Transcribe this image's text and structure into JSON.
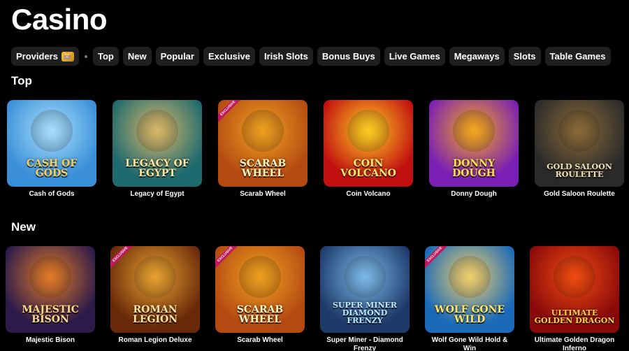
{
  "page": {
    "title": "Casino"
  },
  "filters": {
    "providers_label": "Providers",
    "providers_badge": "🎰",
    "items": [
      "Top",
      "New",
      "Popular",
      "Exclusive",
      "Irish Slots",
      "Bonus Buys",
      "Live Games",
      "Megaways",
      "Slots",
      "Table Games"
    ]
  },
  "sections": {
    "top": {
      "title": "Top",
      "games": [
        {
          "name": "Cash of Gods",
          "logo": "Cash of Gods",
          "bg": "#3a8fd8",
          "bg2": "#a8e0ff",
          "logo_color": "#f5d060",
          "exclusive": false
        },
        {
          "name": "Legacy of Egypt",
          "logo": "Legacy of Egypt",
          "bg": "#1d6a6f",
          "bg2": "#d8b86a",
          "logo_color": "#ffe6a3",
          "exclusive": false
        },
        {
          "name": "Scarab Wheel",
          "logo": "Scarab Wheel",
          "bg": "#b44a12",
          "bg2": "#f0a020",
          "logo_color": "#fff3c0",
          "exclusive": true
        },
        {
          "name": "Coin Volcano",
          "logo": "Coin Volcano",
          "bg": "#c21010",
          "bg2": "#ffcc22",
          "logo_color": "#ffe96a",
          "exclusive": false
        },
        {
          "name": "Donny Dough",
          "logo": "Donny Dough",
          "bg": "#7a1fb4",
          "bg2": "#f5a623",
          "logo_color": "#ffe14a",
          "exclusive": false
        },
        {
          "name": "Gold Saloon Roulette",
          "logo": "Gold Saloon Roulette",
          "bg": "#2a2a2a",
          "bg2": "#8a6a3a",
          "logo_color": "#f0e2b6",
          "exclusive": false
        }
      ]
    },
    "new": {
      "title": "New",
      "games": [
        {
          "name": "Majestic Bison",
          "logo": "Majestic Bison",
          "bg": "#2b1a4a",
          "bg2": "#e07a2a",
          "logo_color": "#ffd98a",
          "exclusive": false
        },
        {
          "name": "Roman Legion Deluxe",
          "logo": "Roman Legion",
          "bg": "#6a2a0a",
          "bg2": "#e8a030",
          "logo_color": "#ffe2a0",
          "exclusive": true
        },
        {
          "name": "Scarab Wheel",
          "logo": "Scarab Wheel",
          "bg": "#b44a12",
          "bg2": "#f0a020",
          "logo_color": "#fff3c0",
          "exclusive": true
        },
        {
          "name": "Super Miner - Diamond Frenzy",
          "logo": "Super Miner Diamond Frenzy",
          "bg": "#1d3a6a",
          "bg2": "#7ab8e8",
          "logo_color": "#bfe8ff",
          "exclusive": false
        },
        {
          "name": "Wolf Gone Wild Hold & Win",
          "logo": "Wolf Gone Wild",
          "bg": "#1a6ab8",
          "bg2": "#f0d070",
          "logo_color": "#ffe66a",
          "exclusive": true
        },
        {
          "name": "Ultimate Golden Dragon Inferno",
          "logo": "Ultimate Golden Dragon",
          "bg": "#8a0a0a",
          "bg2": "#f04a10",
          "logo_color": "#ffd24a",
          "exclusive": false
        }
      ]
    }
  }
}
